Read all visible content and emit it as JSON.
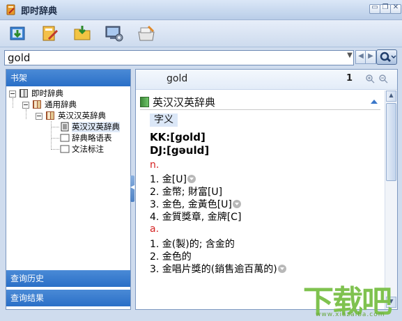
{
  "window": {
    "title": "即时辞典",
    "accent": "#2a6fc7"
  },
  "titlebar_buttons": {
    "minimize": "▭",
    "restore": "❐",
    "close": "✕"
  },
  "toolbar": {
    "tools": [
      "import-icon",
      "edit-dictionary-icon",
      "open-folder-icon",
      "settings-icon",
      "pack-icon"
    ]
  },
  "search": {
    "value": "gold",
    "placeholder": ""
  },
  "left_panel": {
    "bookshelf_header": "书架",
    "tree": {
      "root": "即时辞典",
      "group": "通用辞典",
      "dictionary": "英汉汉英辞典",
      "items": [
        "英汉汉英辞典",
        "辞典略语表",
        "文法标注"
      ]
    },
    "history_header": "查询历史",
    "results_header": "查询结果"
  },
  "right_panel": {
    "headword": "gold",
    "count": "1",
    "dictionary_name": "英汉汉英辞典",
    "section_tag": "字义",
    "pron_kk": "KK:[gold]",
    "pron_dj": "DJ:[gəuld]",
    "pos_noun": "n.",
    "noun_senses": [
      "1. 金[U]",
      "2. 金幣; 財富[U]",
      "3. 金色, 金黃色[U]",
      "4. 金質獎章, 金牌[C]"
    ],
    "pos_adj": "a.",
    "adj_senses": [
      "1. 金(製)的; 含金的",
      "2. 金色的",
      "3. 金唱片獎的(銷售逾百萬的)"
    ]
  },
  "watermark": {
    "text": "下载吧",
    "url": "www.xiazaiba.com"
  }
}
